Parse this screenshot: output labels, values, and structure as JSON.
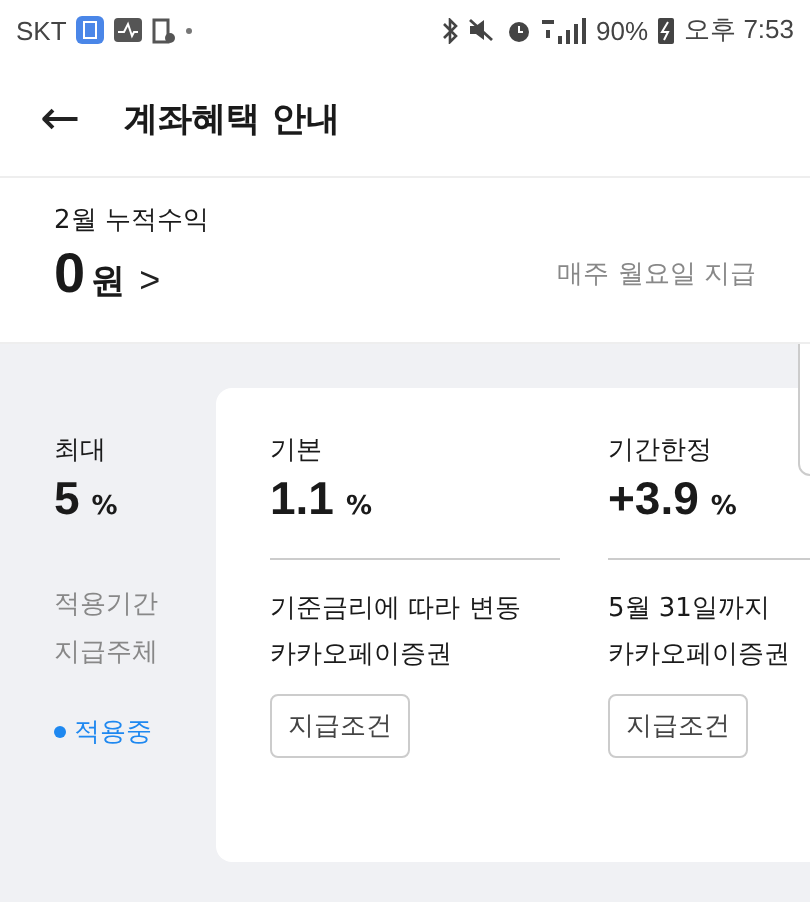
{
  "status_bar": {
    "carrier": "SKT",
    "battery": "90%",
    "time": "오후 7:53"
  },
  "header": {
    "back": "←",
    "title": "계좌혜택 안내"
  },
  "summary": {
    "label": "2월 누적수익",
    "amount": "0",
    "unit": "원",
    "chevron": ">",
    "note": "매주 월요일 지급"
  },
  "side": {
    "max_label": "최대",
    "max_value": "5",
    "max_unit": "%",
    "rows": [
      "적용기간",
      "지급주체"
    ],
    "status": "적용중"
  },
  "benefits": [
    {
      "label": "기본",
      "value": "1.1",
      "unit": "%",
      "period": "기준금리에 따라 변동",
      "payer": "카카오페이증권",
      "button": "지급조건"
    },
    {
      "label": "기간한정",
      "value": "+3.9",
      "unit": "%",
      "period": "5월 31일까지",
      "payer": "카카오페이증권",
      "button": "지급조건"
    }
  ]
}
